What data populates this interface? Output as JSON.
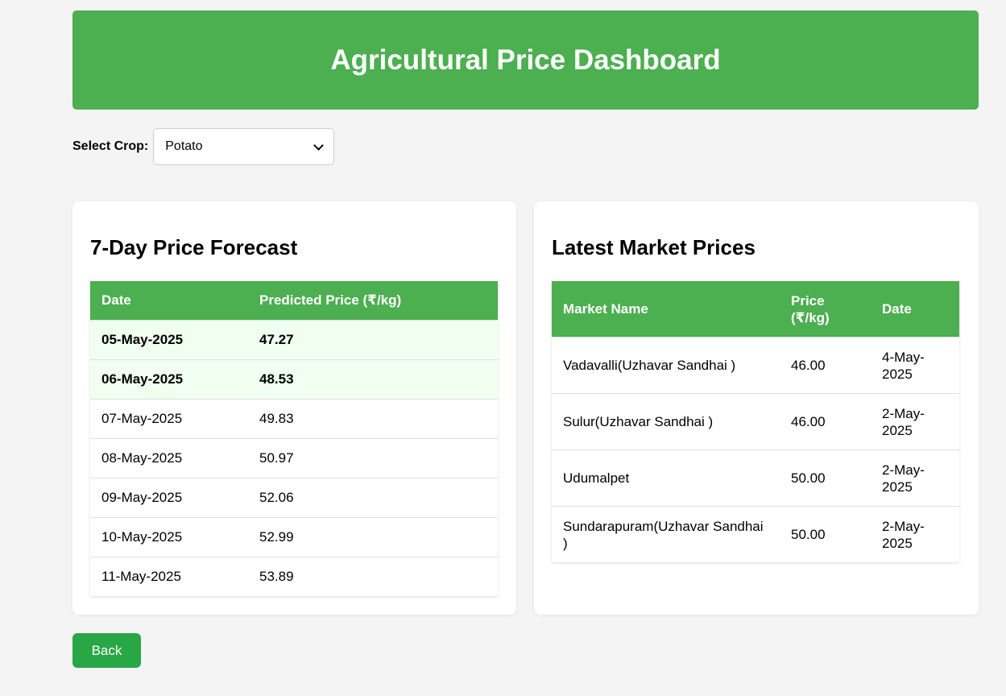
{
  "header": {
    "title": "Agricultural Price Dashboard"
  },
  "crop_selector": {
    "label": "Select Crop:",
    "selected": "Potato"
  },
  "forecast": {
    "title": "7-Day Price Forecast",
    "columns": [
      "Date",
      "Predicted Price (₹/kg)"
    ],
    "rows": [
      {
        "date": "05-May-2025",
        "price": "47.27",
        "highlight": true
      },
      {
        "date": "06-May-2025",
        "price": "48.53",
        "highlight": true
      },
      {
        "date": "07-May-2025",
        "price": "49.83",
        "highlight": false
      },
      {
        "date": "08-May-2025",
        "price": "50.97",
        "highlight": false
      },
      {
        "date": "09-May-2025",
        "price": "52.06",
        "highlight": false
      },
      {
        "date": "10-May-2025",
        "price": "52.99",
        "highlight": false
      },
      {
        "date": "11-May-2025",
        "price": "53.89",
        "highlight": false
      }
    ]
  },
  "market": {
    "title": "Latest Market Prices",
    "columns": [
      "Market Name",
      "Price (₹/kg)",
      "Date"
    ],
    "rows": [
      {
        "name": "Vadavalli(Uzhavar Sandhai )",
        "price": "46.00",
        "date": "4-May-2025"
      },
      {
        "name": "Sulur(Uzhavar Sandhai )",
        "price": "46.00",
        "date": "2-May-2025"
      },
      {
        "name": "Udumalpet",
        "price": "50.00",
        "date": "2-May-2025"
      },
      {
        "name": "Sundarapuram(Uzhavar Sandhai )",
        "price": "50.00",
        "date": "2-May-2025"
      }
    ]
  },
  "actions": {
    "back_label": "Back"
  },
  "colors": {
    "accent": "#4caf50",
    "back_button": "#28a745",
    "highlight_row": "#f0fff0"
  }
}
